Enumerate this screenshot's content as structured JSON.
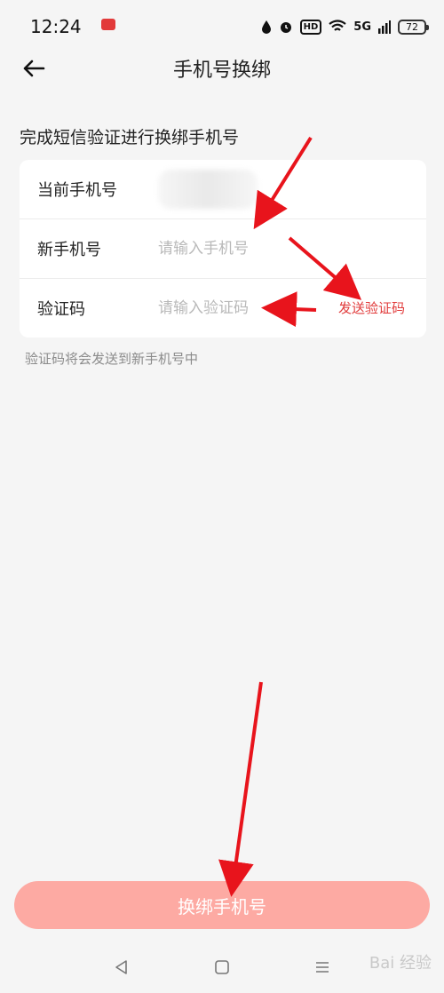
{
  "status_bar": {
    "time": "12:24",
    "hd": "HD",
    "network": "5G",
    "battery": "72"
  },
  "nav": {
    "title": "手机号换绑"
  },
  "section_title": "完成短信验证进行换绑手机号",
  "form": {
    "current_phone_label": "当前手机号",
    "new_phone_label": "新手机号",
    "new_phone_placeholder": "请输入手机号",
    "code_label": "验证码",
    "code_placeholder": "请输入验证码",
    "send_code_label": "发送验证码"
  },
  "hint": "验证码将会发送到新手机号中",
  "submit_label": "换绑手机号",
  "watermark": "Bai 经验",
  "colors": {
    "accent": "#e13b3b",
    "button": "#fdaaa3",
    "background": "#f5f5f5",
    "arrow": "#e8141c"
  }
}
